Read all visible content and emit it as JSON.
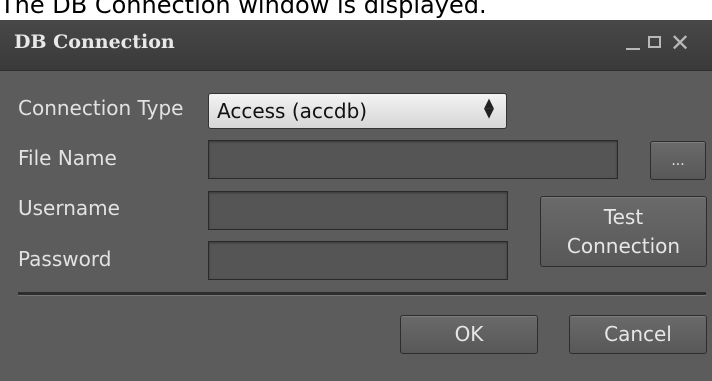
{
  "caption": "The DB Connection window is displayed.",
  "window": {
    "title": "DB Connection",
    "controls": {
      "minimize": "_",
      "close": "✕"
    }
  },
  "form": {
    "connection_type": {
      "label": "Connection Type",
      "selected": "Access (accdb)",
      "arrows": "▲\n▼"
    },
    "file_name": {
      "label": "File Name",
      "value": "",
      "browse_label": "..."
    },
    "username": {
      "label": "Username",
      "value": ""
    },
    "password": {
      "label": "Password",
      "value": ""
    },
    "test_connection_label": "Test\nConnection"
  },
  "footer": {
    "ok_label": "OK",
    "cancel_label": "Cancel"
  }
}
